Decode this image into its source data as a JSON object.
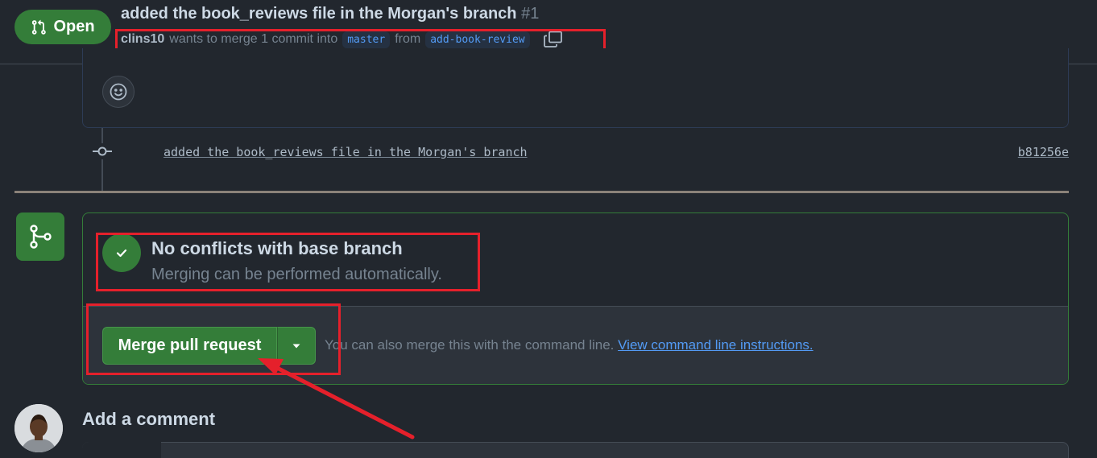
{
  "header": {
    "status_label": "Open",
    "title": "added the book_reviews file in the Morgan's branch",
    "number": "#1",
    "author": "clins10",
    "merge_text": "wants to merge 1 commit into",
    "base_branch": "master",
    "from_text": "from",
    "head_branch": "add-book-review",
    "copy_icon": "copy-icon"
  },
  "timeline": {
    "reaction_icon": "smiley-icon",
    "commit": {
      "message": "added the book_reviews file in the Morgan's branch",
      "sha": "b81256e"
    }
  },
  "merge_box": {
    "status_title": "No conflicts with base branch",
    "status_subtitle": "Merging can be performed automatically.",
    "merge_button_label": "Merge pull request",
    "hint_text": "You can also merge this with the command line.",
    "hint_link": "View command line instructions."
  },
  "comment": {
    "title": "Add a comment"
  },
  "colors": {
    "background": "#22272e",
    "success": "#347d39",
    "link": "#539bf5",
    "highlight": "#e5202b"
  }
}
